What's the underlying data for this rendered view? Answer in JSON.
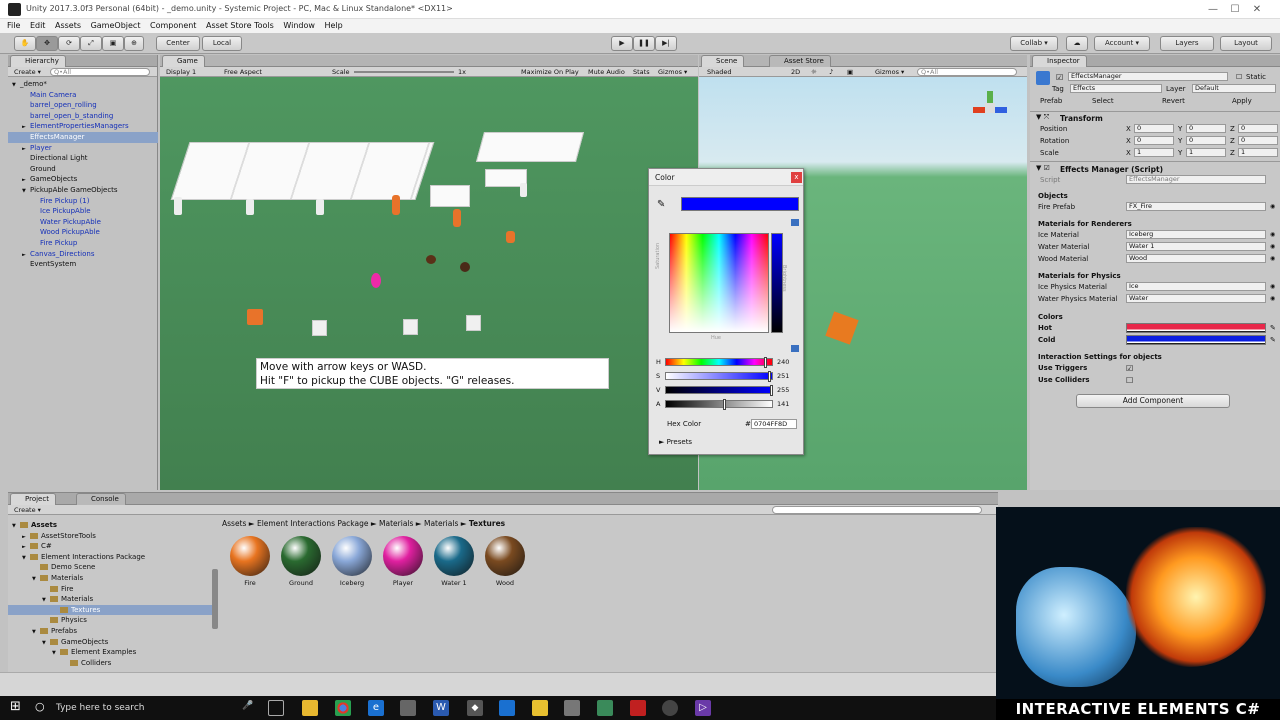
{
  "window": {
    "title": "Unity 2017.3.0f3 Personal (64bit) - _demo.unity - Systemic Project - PC, Mac & Linux Standalone* <DX11>",
    "controls": [
      "—",
      "☐",
      "✕"
    ]
  },
  "menu": [
    "File",
    "Edit",
    "Assets",
    "GameObject",
    "Component",
    "Asset Store Tools",
    "Window",
    "Help"
  ],
  "toolbar": {
    "pivot": "Center",
    "space": "Local",
    "collab": "Collab ▾",
    "account": "Account ▾",
    "layers": "Layers",
    "layout": "Layout"
  },
  "hierarchy": {
    "tab": "Hierarchy",
    "create": "Create ▾",
    "search_placeholder": "Q•All",
    "items": [
      {
        "label": "_demo*",
        "indent": 0,
        "color": "black",
        "arrow": "▼"
      },
      {
        "label": "Main Camera",
        "indent": 1,
        "color": "blue",
        "arrow": ""
      },
      {
        "label": "barrel_open_rolling",
        "indent": 1,
        "color": "blue",
        "arrow": ""
      },
      {
        "label": "barrel_open_b_standing",
        "indent": 1,
        "color": "blue",
        "arrow": ""
      },
      {
        "label": "ElementPropertiesManagers",
        "indent": 1,
        "color": "blue",
        "arrow": "►"
      },
      {
        "label": "EffectsManager",
        "indent": 1,
        "color": "selected",
        "arrow": ""
      },
      {
        "label": "Player",
        "indent": 1,
        "color": "blue",
        "arrow": "►"
      },
      {
        "label": "Directional Light",
        "indent": 1,
        "color": "black",
        "arrow": ""
      },
      {
        "label": "Ground",
        "indent": 1,
        "color": "black",
        "arrow": ""
      },
      {
        "label": "GameObjects",
        "indent": 1,
        "color": "black",
        "arrow": "►"
      },
      {
        "label": "PickupAble GameObjects",
        "indent": 1,
        "color": "black",
        "arrow": "▼"
      },
      {
        "label": "Fire Pickup (1)",
        "indent": 2,
        "color": "blue",
        "arrow": ""
      },
      {
        "label": "Ice PickupAble",
        "indent": 2,
        "color": "blue",
        "arrow": ""
      },
      {
        "label": "Water PickupAble",
        "indent": 2,
        "color": "blue",
        "arrow": ""
      },
      {
        "label": "Wood PickupAble",
        "indent": 2,
        "color": "blue",
        "arrow": ""
      },
      {
        "label": "Fire Pickup",
        "indent": 2,
        "color": "blue",
        "arrow": ""
      },
      {
        "label": "Canvas_Directions",
        "indent": 1,
        "color": "blue",
        "arrow": "►"
      },
      {
        "label": "EventSystem",
        "indent": 1,
        "color": "black",
        "arrow": ""
      }
    ]
  },
  "game": {
    "tab": "Game",
    "display": "Display 1",
    "aspect": "Free Aspect",
    "scale_label": "Scale",
    "scale_value": "1x",
    "options": [
      "Maximize On Play",
      "Mute Audio",
      "Stats",
      "Gizmos ▾"
    ],
    "instructions": [
      "Move with arrow keys or WASD.",
      "Hit \"F\" to pickup the CUBE objects. \"G\" releases."
    ]
  },
  "scene": {
    "tab": "Scene",
    "tab2": "Asset Store",
    "shading": "Shaded",
    "mode": "2D",
    "gizmos": "Gizmos ▾",
    "search": "Q•All"
  },
  "color_picker": {
    "title": "Color",
    "close": "x",
    "color_hex": "#0000ff",
    "wheel_labels": {
      "saturation": "Saturation",
      "hue": "Hue",
      "brightness": "Brightness"
    },
    "sliders": [
      {
        "label": "H",
        "value": "240",
        "level": 0.94
      },
      {
        "label": "S",
        "value": "251",
        "level": 0.98
      },
      {
        "label": "V",
        "value": "255",
        "level": 1.0
      },
      {
        "label": "A",
        "value": "141",
        "level": 0.55
      }
    ],
    "hex_label": "Hex Color",
    "hex_value": "0704FF8D",
    "presets": "Presets"
  },
  "inspector": {
    "tab": "Inspector",
    "object_name": "EffectsManager",
    "static_label": "Static",
    "tag_label": "Tag",
    "tag_value": "Effects",
    "layer_label": "Layer",
    "layer_value": "Default",
    "prefab_label": "Prefab",
    "prefab_buttons": [
      "Select",
      "Revert",
      "Apply"
    ],
    "transform": {
      "header": "Transform",
      "rows": [
        {
          "label": "Position",
          "x": "0",
          "y": "0",
          "z": "0"
        },
        {
          "label": "Rotation",
          "x": "0",
          "y": "0",
          "z": "0"
        },
        {
          "label": "Scale",
          "x": "1",
          "y": "1",
          "z": "1"
        }
      ]
    },
    "script_component": {
      "header": "Effects Manager (Script)",
      "script_label": "Script",
      "script_value": "EffectsManager",
      "sections": [
        {
          "title": "Objects",
          "rows": [
            {
              "label": "Fire Prefab",
              "value": "FX_Fire"
            }
          ]
        },
        {
          "title": "Materials for Renderers",
          "rows": [
            {
              "label": "Ice Material",
              "value": "Iceberg"
            },
            {
              "label": "Water Material",
              "value": "Water 1"
            },
            {
              "label": "Wood Material",
              "value": "Wood"
            }
          ]
        },
        {
          "title": "Materials for Physics",
          "rows": [
            {
              "label": "Ice Physics Material",
              "value": "Ice"
            },
            {
              "label": "Water Physics Material",
              "value": "Water"
            }
          ]
        }
      ],
      "colors_title": "Colors",
      "colors": [
        {
          "label": "Hot",
          "color": "#e8274a"
        },
        {
          "label": "Cold",
          "color": "#0a1ee0"
        }
      ],
      "interaction_title": "Interaction Settings for objects",
      "toggles": [
        {
          "label": "Use Triggers",
          "checked": true
        },
        {
          "label": "Use Colliders",
          "checked": false
        }
      ]
    },
    "add_component": "Add Component"
  },
  "project": {
    "tab": "Project",
    "tab2": "Console",
    "create": "Create ▾",
    "tree": [
      {
        "label": "Assets",
        "indent": 0,
        "arrow": "▼",
        "bold": true
      },
      {
        "label": "AssetStoreTools",
        "indent": 1,
        "arrow": "►"
      },
      {
        "label": "C#",
        "indent": 1,
        "arrow": "►"
      },
      {
        "label": "Element Interactions Package",
        "indent": 1,
        "arrow": "▼"
      },
      {
        "label": "Demo Scene",
        "indent": 2,
        "arrow": ""
      },
      {
        "label": "Materials",
        "indent": 2,
        "arrow": "▼"
      },
      {
        "label": "Fire",
        "indent": 3,
        "arrow": ""
      },
      {
        "label": "Materials",
        "indent": 3,
        "arrow": "▼"
      },
      {
        "label": "Textures",
        "indent": 4,
        "arrow": "",
        "selected": true
      },
      {
        "label": "Physics",
        "indent": 3,
        "arrow": ""
      },
      {
        "label": "Prefabs",
        "indent": 2,
        "arrow": "▼"
      },
      {
        "label": "GameObjects",
        "indent": 3,
        "arrow": "▼"
      },
      {
        "label": "Element Examples",
        "indent": 4,
        "arrow": "▼"
      },
      {
        "label": "Colliders",
        "indent": 5,
        "arrow": ""
      }
    ],
    "breadcrumb": [
      "Assets",
      "Element Interactions Package",
      "Materials",
      "Materials",
      "Textures"
    ],
    "assets": [
      {
        "label": "Fire",
        "color": "#e87420"
      },
      {
        "label": "Ground",
        "color": "#2a6a30"
      },
      {
        "label": "Iceberg",
        "color": "#8aa8d8"
      },
      {
        "label": "Player",
        "color": "#e020a0"
      },
      {
        "label": "Water 1",
        "color": "#1a6a8a"
      },
      {
        "label": "Wood",
        "color": "#7a4a20"
      }
    ]
  },
  "taskbar": {
    "search_placeholder": "Type here to search"
  },
  "promo": {
    "text": "INTERACTIVE ELEMENTS C#"
  }
}
